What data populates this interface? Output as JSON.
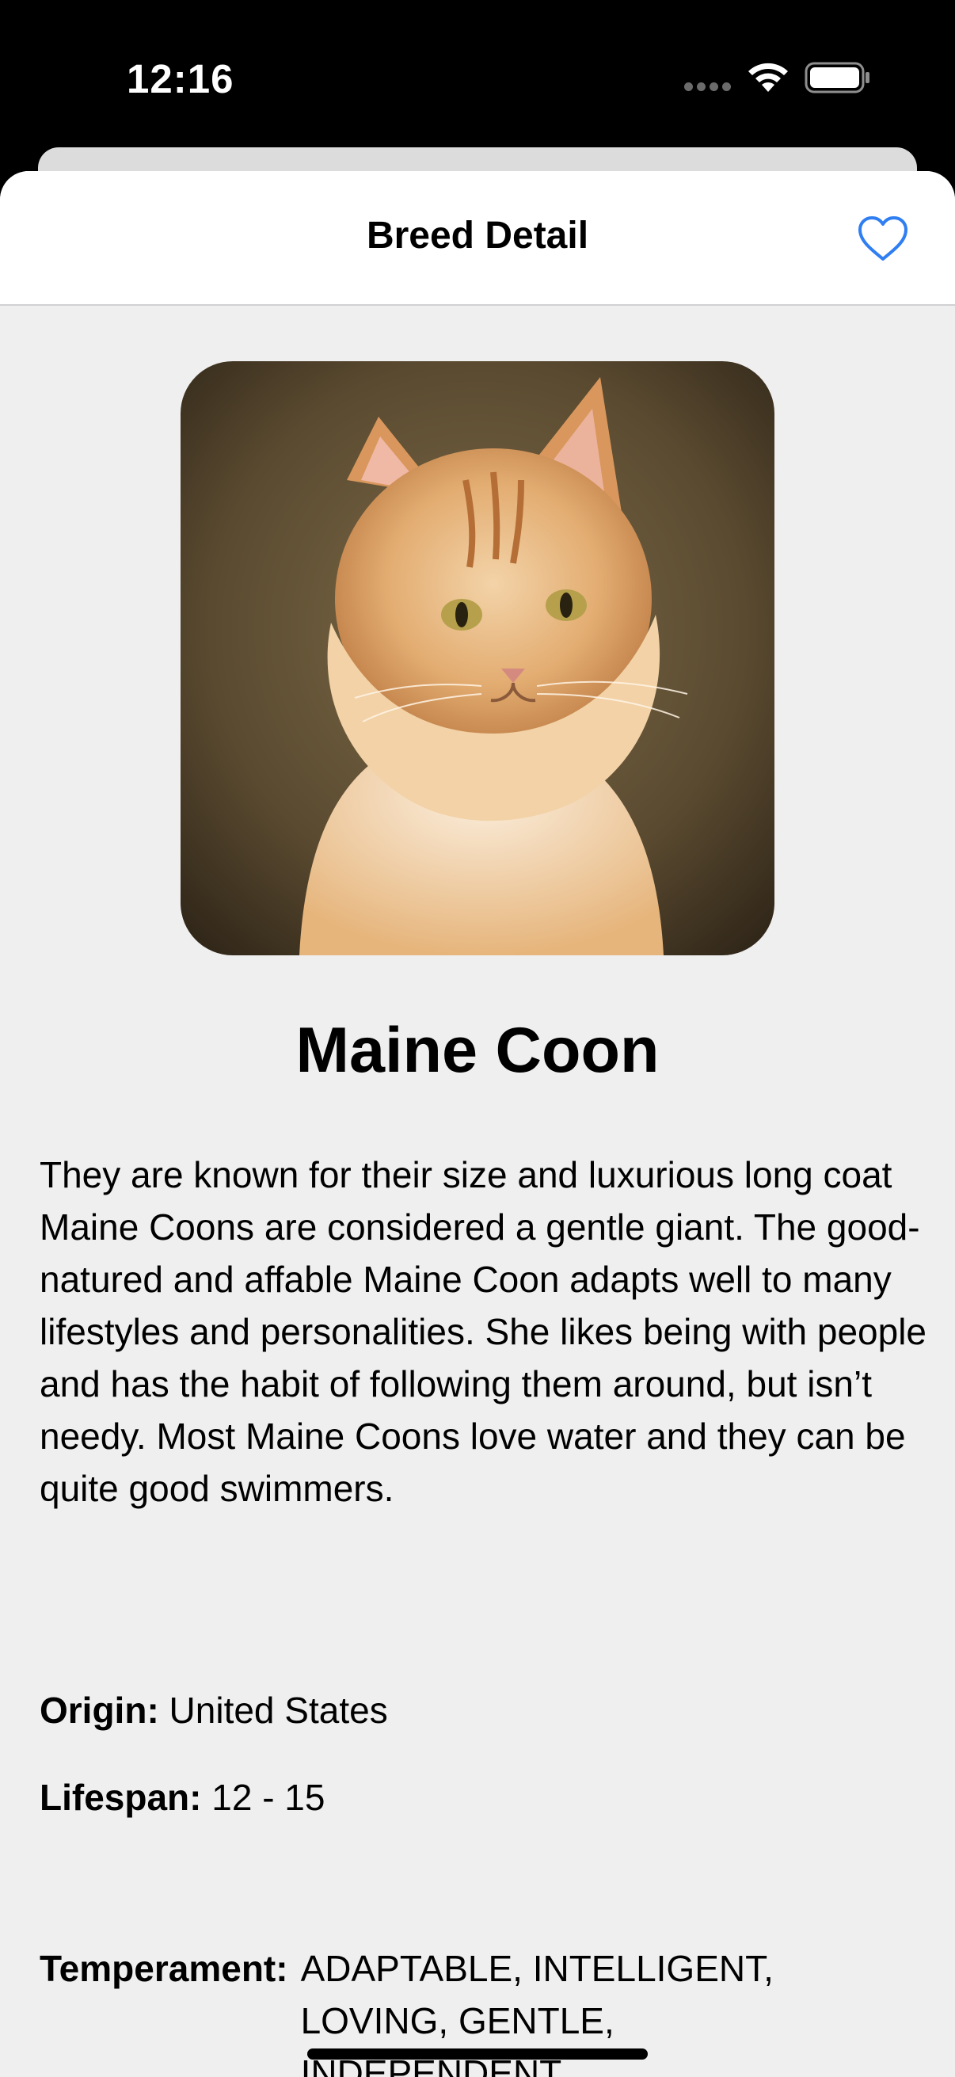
{
  "status_bar": {
    "time": "12:16"
  },
  "nav": {
    "title": "Breed Detail",
    "favorite_icon": "heart-outline-icon",
    "accent_color": "#2f7ef2"
  },
  "breed": {
    "name": "Maine Coon",
    "image_alt": "Maine Coon cat photo",
    "description": "They are known for their size and luxurious long coat Maine Coons are considered a gentle giant. The good-natured and affable Maine Coon adapts well to many lifestyles and personalities. She likes being with people and has the habit of following them around, but isn’t needy. Most Maine Coons love water and they can be quite good swimmers.",
    "origin_label": "Origin:",
    "origin_value": "United States",
    "lifespan_label": "Lifespan:",
    "lifespan_value": "12 - 15",
    "temperament_label": "Temperament:",
    "temperament_value": "ADAPTABLE, INTELLIGENT, LOVING, GENTLE, INDEPENDENT"
  }
}
